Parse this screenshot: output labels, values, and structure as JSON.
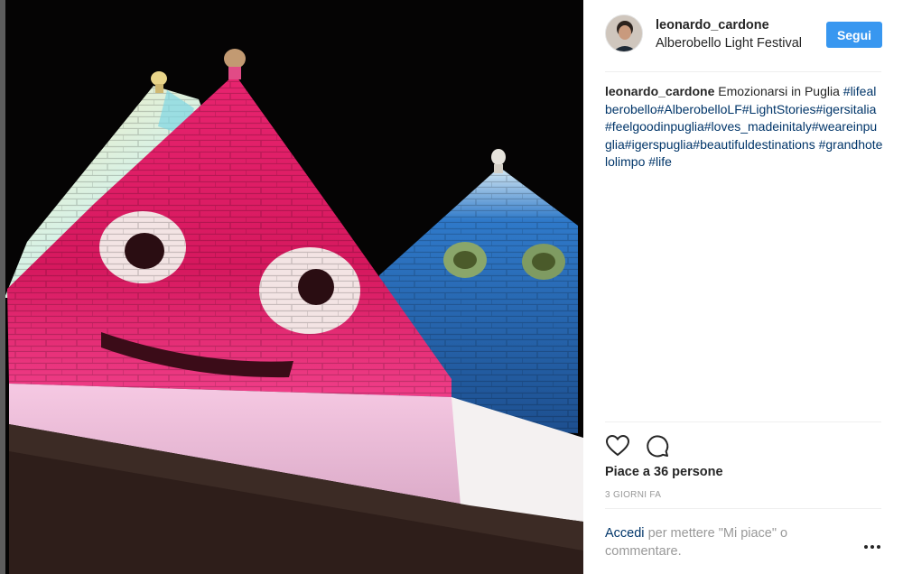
{
  "post": {
    "username": "leonardo_cardone",
    "location": "Alberobello Light Festival",
    "follow_label": "Segui",
    "caption": {
      "username": "leonardo_cardone",
      "text": "Emozionarsi in Puglia",
      "hashtags": "#lifealberobello#AlberobelloLF#LightStories#igersitalia#feelgoodinpuglia#loves_madeinitaly#weareinpuglia#igerspuglia#beautifuldestinations #grandhotelolimpo #life"
    },
    "likes": "Piace a 36 persone",
    "timestamp": "3 GIORNI FA",
    "login_prompt": {
      "link": "Accedi",
      "text": "per mettere \"Mi piace\" o commentare."
    }
  },
  "icons": {
    "like": "heart-icon",
    "comment": "comment-bubble-icon",
    "more": "more-options-icon"
  },
  "colors": {
    "follow_button": "#3897f0",
    "hashtag_link": "#003569",
    "secondary_text": "#999999"
  }
}
